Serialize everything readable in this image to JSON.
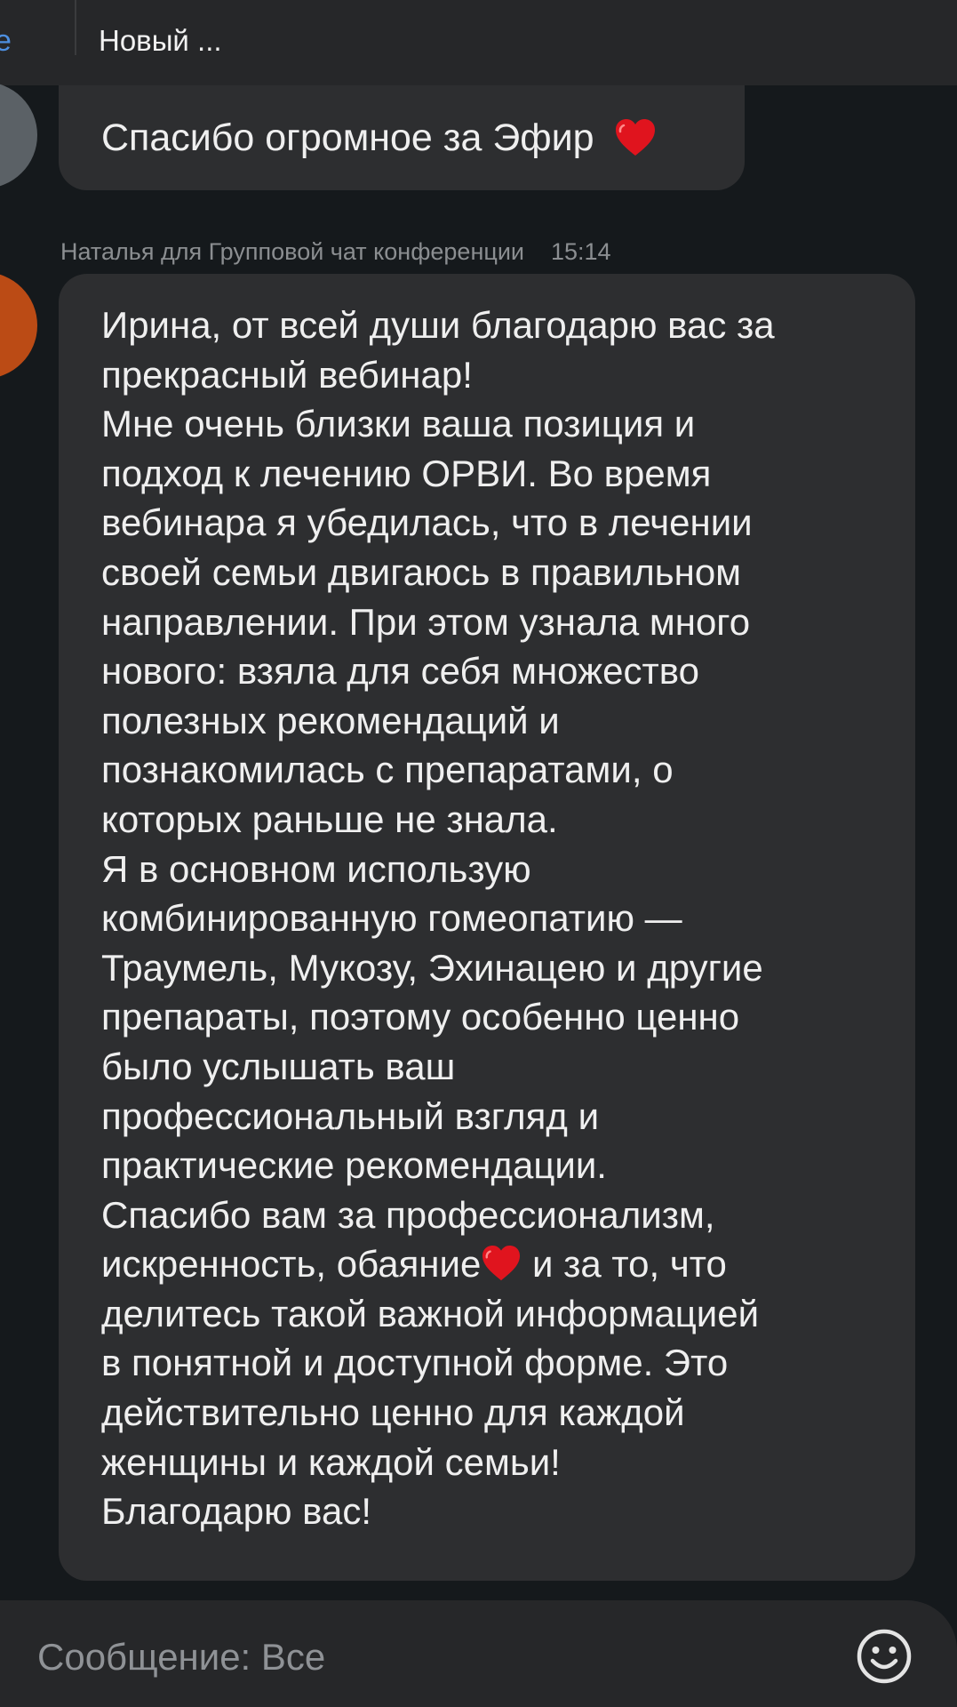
{
  "header": {
    "back_fragment": "е",
    "title": "Новый ..."
  },
  "messages": [
    {
      "text": "Спасибо огромное за Эфир",
      "emoji": "heart-icon"
    },
    {
      "sender": "Наталья для Групповой чат конференции",
      "time": "15:14",
      "lines": [
        "Ирина, от всей души благодарю вас за",
        "прекрасный вебинар!",
        "Мне очень близки ваша позиция и",
        "подход к лечению ОРВИ. Во время",
        "вебинара я убедилась, что в лечении",
        "своей семьи двигаюсь в правильном",
        "направлении. При этом узнала много",
        "нового: взяла для себя множество",
        "полезных рекомендаций и",
        "познакомилась с препаратами, о",
        "которых раньше не знала.",
        "Я в основном использую",
        "комбинированную гомеопатию —",
        "Траумель, Мукозу, Эхинацею и другие",
        "препараты, поэтому особенно ценно",
        "было услышать ваш",
        "профессиональный взгляд и",
        "практические рекомендации.",
        "Спасибо вам за профессионализм,"
      ],
      "heart_line_before": "искренность, обаяние",
      "heart_line_after": " и за то, что",
      "lines_end": [
        "делитесь такой важной информацией",
        "в понятной и доступной форме. Это",
        "действительно ценно для каждой",
        "женщины и каждой семьи!",
        "Благодарю вас!"
      ]
    }
  ],
  "composer": {
    "placeholder": "Сообщение: Все",
    "emoji_icon": "smiley-icon"
  },
  "colors": {
    "background": "#15191c",
    "bubble": "#2d2e30",
    "bar": "#262729",
    "heart": "#e0141e",
    "avatar_grey": "#5b6166",
    "avatar_orange": "#bb4b15",
    "link": "#4d8fe0"
  }
}
